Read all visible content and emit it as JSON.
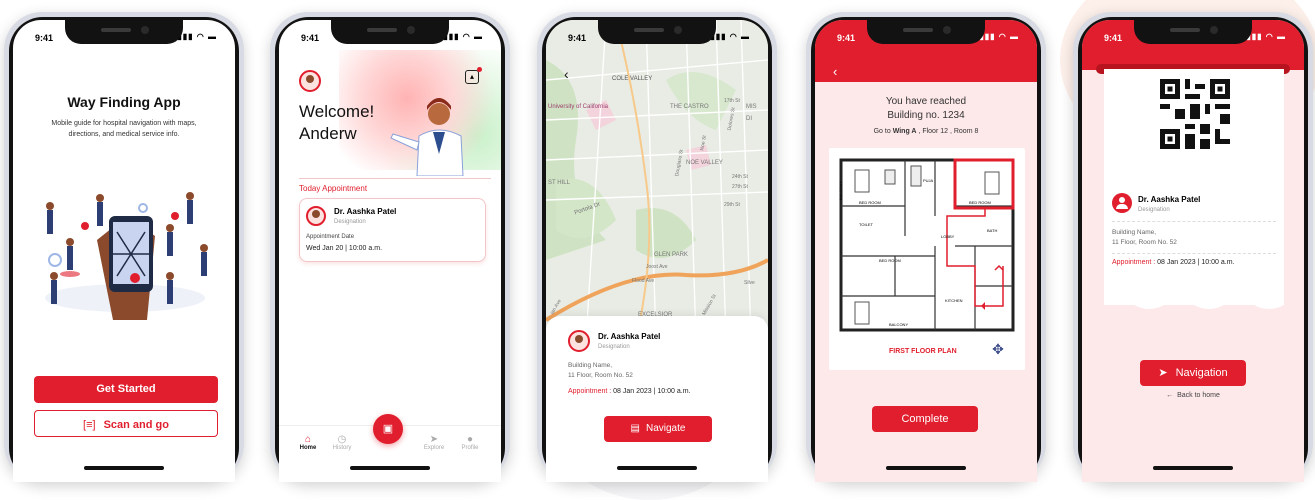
{
  "colors": {
    "accent": "#e01e2d",
    "pink_bg": "#fde8ea",
    "map_green": "#cfe3c4"
  },
  "status_time": "9:41",
  "screen1": {
    "title": "Way Finding App",
    "subtitle": "Mobile guide for hospital navigation with maps, directions, and medical service info.",
    "primary_button": "Get Started",
    "secondary_button": "Scan and go"
  },
  "screen2": {
    "greeting_line1": "Welcome!",
    "greeting_line2": "Anderw",
    "section_title": "Today Appointment",
    "doctor_name": "Dr. Aashka Patel",
    "doctor_designation": "Designation",
    "appointment_label": "Appointment Date",
    "appointment_value": "Wed Jan 20 | 10:00 a.m.",
    "tabs": [
      {
        "label": "Home",
        "icon": "home-icon"
      },
      {
        "label": "History",
        "icon": "history-icon"
      },
      {
        "label": "Explore",
        "icon": "explore-icon"
      },
      {
        "label": "Profile",
        "icon": "profile-icon"
      }
    ]
  },
  "screen3": {
    "map_labels": [
      "COLE VALLEY",
      "University of California",
      "THE CASTRO",
      "MIS",
      "DI",
      "17th St",
      "Dolores St",
      "Noe St",
      "NOE VALLEY",
      "Douglass St",
      "24th St",
      "27th St",
      "29th St",
      "ST HILL",
      "Portola Dr",
      "GLEN PARK",
      "Joost Ave",
      "Flood Ave",
      "Silve",
      "ian Ave",
      "Mission St",
      "EXCELSIOR"
    ],
    "doctor_name": "Dr. Aashka Patel",
    "doctor_designation": "Designation",
    "address_line1": "Building Name,",
    "address_line2": "11 Floor, Room No. 52",
    "appointment_label": "Appointment :",
    "appointment_value": "08 Jan 2023 | 10:00 a.m.",
    "button": "Navigate"
  },
  "screen4": {
    "reached_line1": "You have reached",
    "reached_line2": "Building no. 1234",
    "goto_prefix": "Go to",
    "wing": "Wing A",
    "floor": "Floor 12",
    "room": "Room 8",
    "plan_labels": [
      "BED ROOM",
      "PUJA",
      "BED ROOM",
      "TOILET",
      "LOBBY",
      "BATH",
      "BED ROOM",
      "KITCHEN",
      "BALCONY",
      "BALCONY"
    ],
    "plan_title": "FIRST FLOOR PLAN",
    "button": "Complete"
  },
  "screen5": {
    "doctor_name": "Dr. Aashka Patel",
    "doctor_designation": "Designation",
    "address_line1": "Building Name,",
    "address_line2": "11 Floor, Room No. 52",
    "appointment_label": "Appointment :",
    "appointment_value": "08 Jan 2023 | 10:00 a.m.",
    "button": "Navigation",
    "back_link": "Back to home"
  }
}
